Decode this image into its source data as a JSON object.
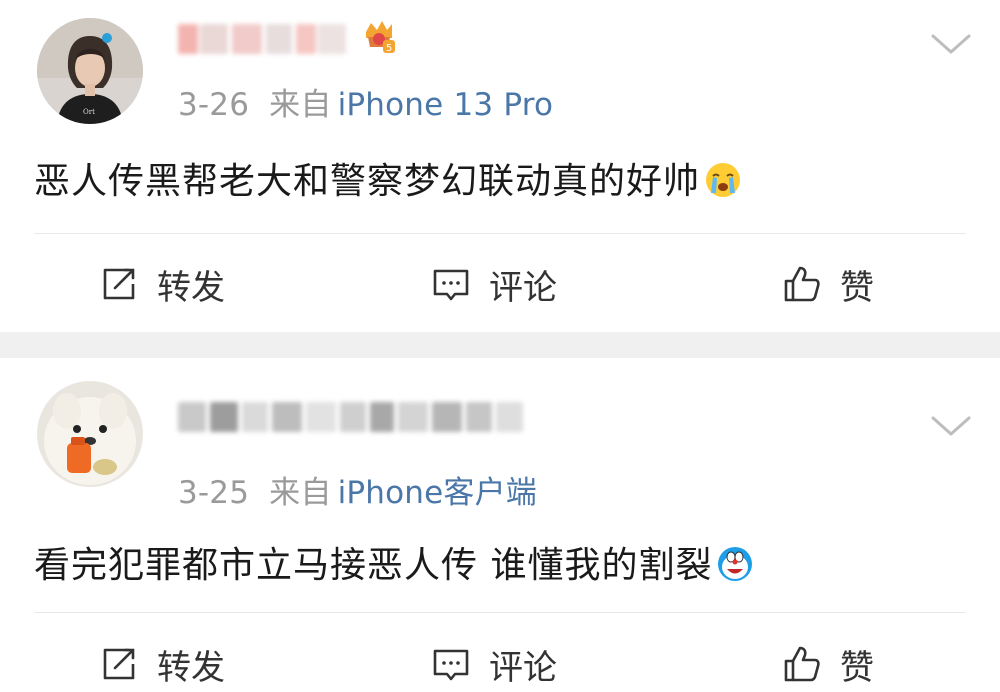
{
  "posts": [
    {
      "date": "3-26",
      "source_prefix": "来自",
      "device": "iPhone 13 Pro",
      "badge_level": "5",
      "content": "恶人传黑帮老大和警察梦幻联动真的好帅",
      "emoji": "crying-emoji",
      "actions": {
        "repost": "转发",
        "comment": "评论",
        "like": "赞"
      }
    },
    {
      "date": "3-25",
      "source_prefix": "来自",
      "device": "iPhone客户端",
      "content": "看完犯罪都市立马接恶人传 谁懂我的割裂",
      "emoji": "doraemon-emoji",
      "actions": {
        "repost": "转发",
        "comment": "评论",
        "like": "赞"
      }
    }
  ],
  "colors": {
    "link_blue": "#4a77a8",
    "meta_gray": "#9a9a9a",
    "separator": "#f0f0f0",
    "badge_orange": "#f4a531"
  },
  "icons": [
    "chevron-down-icon",
    "repost-icon",
    "comment-icon",
    "like-icon",
    "crown-badge-icon"
  ]
}
